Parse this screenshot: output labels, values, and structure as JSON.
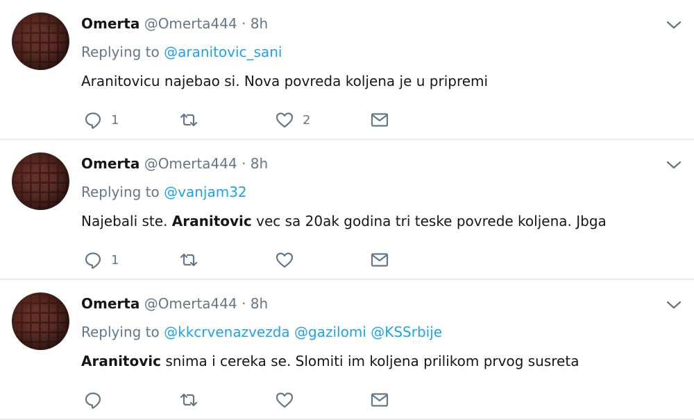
{
  "tweets": [
    {
      "name": "Omerta",
      "handle": "@Omerta444",
      "dot": "·",
      "time": "8h",
      "replying_prefix": "Replying to",
      "mentions": [
        "@aranitovic_sani"
      ],
      "text_bold": "",
      "text": "Aranitovicu najebao si. Nova povreda koljena je u pripremi",
      "reply_count": "1",
      "retweet_count": "",
      "like_count": "2"
    },
    {
      "name": "Omerta",
      "handle": "@Omerta444",
      "dot": "·",
      "time": "8h",
      "replying_prefix": "Replying to",
      "mentions": [
        "@vanjam32"
      ],
      "text_pre": "Najebali ste. ",
      "text_bold": "Aranitovic",
      "text": " vec sa 20ak godina tri teske povrede koljena. Jbga",
      "reply_count": "1",
      "retweet_count": "",
      "like_count": ""
    },
    {
      "name": "Omerta",
      "handle": "@Omerta444",
      "dot": "·",
      "time": "8h",
      "replying_prefix": "Replying to",
      "mentions": [
        "@kkcrvenazvezda",
        "@gazilomi",
        "@KSSrbije"
      ],
      "text_bold": "Aranitovic",
      "text": " snima i cereka se. Slomiti im koljena prilikom prvog susreta",
      "reply_count": "",
      "retweet_count": "",
      "like_count": ""
    }
  ],
  "icons": {
    "menu": "chevron-down-icon",
    "reply": "reply-icon",
    "retweet": "retweet-icon",
    "like": "heart-icon",
    "dm": "envelope-icon"
  },
  "colors": {
    "link": "#1da1f2",
    "muted": "#657786",
    "text": "#14171a",
    "divider": "#e6ecf0"
  }
}
